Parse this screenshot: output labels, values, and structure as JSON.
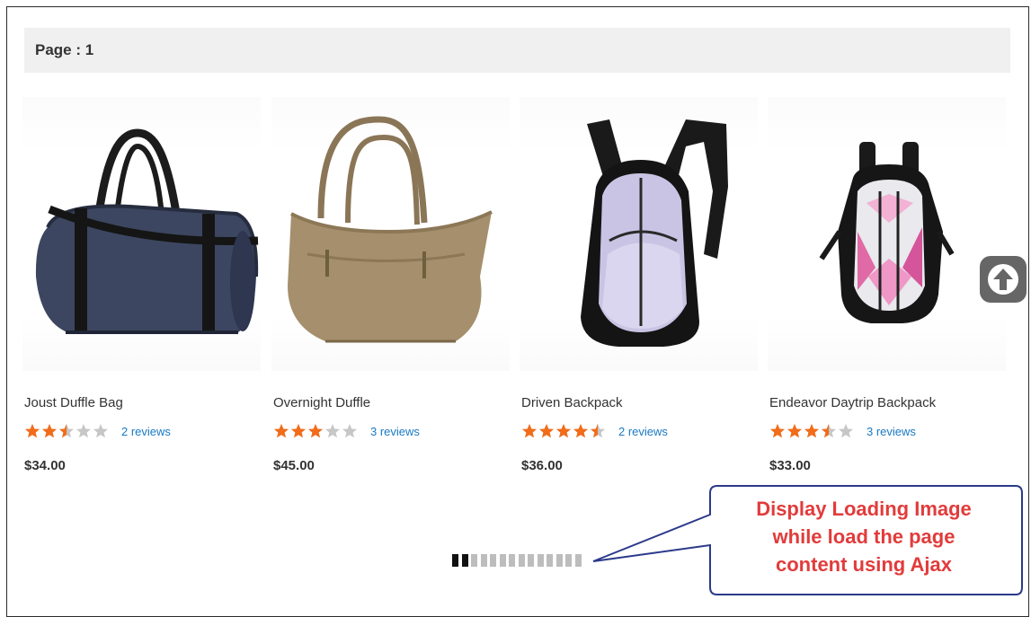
{
  "page_bar": {
    "label": "Page : 1"
  },
  "products": [
    {
      "name": "Joust Duffle Bag",
      "rating": 2.5,
      "reviews": "2 reviews",
      "price": "$34.00",
      "image": "duffle-bag"
    },
    {
      "name": "Overnight Duffle",
      "rating": 3,
      "reviews": "3 reviews",
      "price": "$45.00",
      "image": "tan-tote-bag"
    },
    {
      "name": "Driven Backpack",
      "rating": 4.5,
      "reviews": "2 reviews",
      "price": "$36.00",
      "image": "lavender-backpack"
    },
    {
      "name": "Endeavor Daytrip Backpack",
      "rating": 3.5,
      "reviews": "3 reviews",
      "price": "$33.00",
      "image": "pink-backpack"
    }
  ],
  "loader": {
    "segments": 14,
    "active_segments": 2
  },
  "callout": {
    "lines": [
      "Display Loading Image",
      "while load the page",
      "content using Ajax"
    ]
  },
  "colors": {
    "star_on": "#f26c1a",
    "star_off": "#c7c7c7",
    "link": "#1979c3",
    "callout_text": "#e23b3b",
    "callout_border": "#2b3a8a"
  },
  "icons": {
    "scroll_top": "arrow-up-circle-icon"
  }
}
